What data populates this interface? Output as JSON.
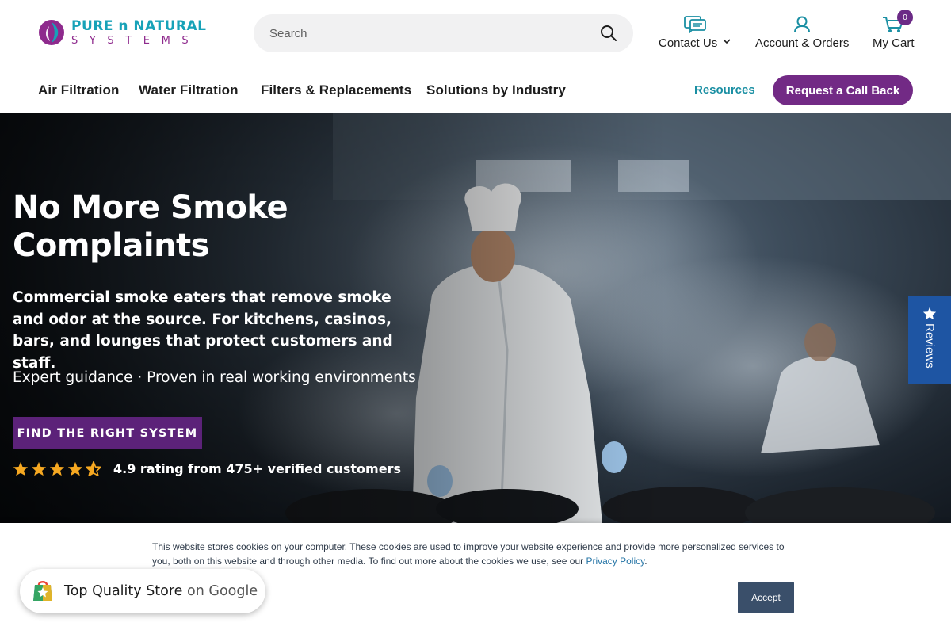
{
  "brand": {
    "line1": "PURE n NATURAL",
    "line2": "SYSTEMS",
    "colors": {
      "teal": "#17a2b8",
      "purple": "#8e2a8d",
      "accent": "#722a85"
    }
  },
  "search": {
    "placeholder": "Search",
    "icon": "search-icon"
  },
  "header_links": {
    "contact": "Contact Us",
    "account": "Account & Orders",
    "cart": "My Cart",
    "cart_count": "0"
  },
  "nav": {
    "items": [
      "Air Filtration",
      "Water Filtration",
      "Filters & Replacements",
      "Solutions by Industry"
    ],
    "resources": "Resources",
    "callback": "Request a Call Back"
  },
  "hero": {
    "title": "No More Smoke Complaints",
    "subtitle": "Commercial smoke eaters that remove smoke and odor at the source. For kitchens, casinos, bars, and lounges that protect customers and staff.",
    "guidance": "Expert guidance · Proven in real working environments",
    "cta": "FIND THE RIGHT SYSTEM",
    "rating_text": "4.9 rating from 475+ verified customers",
    "rating_value": 4.5
  },
  "reviews_tab": {
    "label": "Reviews"
  },
  "cookie": {
    "text": "This website stores cookies on your computer. These cookies are used to improve your website experience and provide more personalized services to you, both on this website and through other media. To find out more about the cookies we use, see our ",
    "link": "Privacy Policy",
    "after": ".",
    "accept": "Accept"
  },
  "google_badge": {
    "title": "Top Quality Store",
    "sub": "on Google"
  }
}
